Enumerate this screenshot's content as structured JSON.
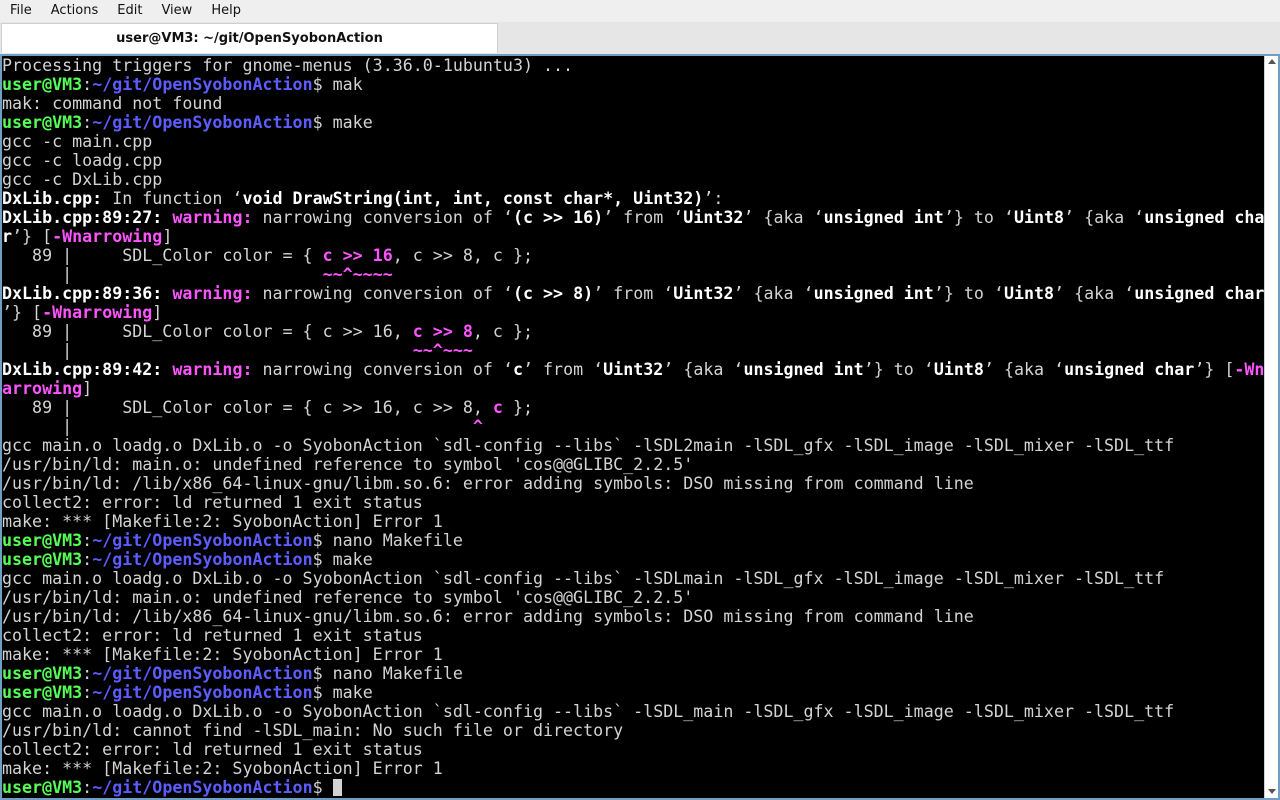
{
  "menubar": {
    "items": [
      "File",
      "Actions",
      "Edit",
      "View",
      "Help"
    ]
  },
  "tab": {
    "title": "user@VM3: ~/git/OpenSyobonAction"
  },
  "prompt": {
    "user": "user@VM3",
    "path": "~/git/OpenSyobonAction"
  },
  "lines": [
    [
      [
        "",
        "Processing triggers for gnome-menus (3.36.0-1ubuntu3) ..."
      ]
    ],
    [
      [
        "pu",
        "user@VM3"
      ],
      [
        "",
        ":"
      ],
      [
        "pp",
        "~/git/OpenSyobonAction"
      ],
      [
        "",
        "$ mak"
      ]
    ],
    [
      [
        "",
        "mak: command not found"
      ]
    ],
    [
      [
        "pu",
        "user@VM3"
      ],
      [
        "",
        ":"
      ],
      [
        "pp",
        "~/git/OpenSyobonAction"
      ],
      [
        "",
        "$ make"
      ]
    ],
    [
      [
        "",
        "gcc -c main.cpp"
      ]
    ],
    [
      [
        "",
        "gcc -c loadg.cpp"
      ]
    ],
    [
      [
        "",
        "gcc -c DxLib.cpp"
      ]
    ],
    [
      [
        "b",
        "DxLib.cpp:"
      ],
      [
        "",
        " In function ‘"
      ],
      [
        "b",
        "void DrawString(int, int, const char*, Uint32)"
      ],
      [
        "",
        "’:"
      ]
    ],
    [
      [
        "b",
        "DxLib.cpp:89:27:"
      ],
      [
        "",
        " "
      ],
      [
        "w",
        "warning:"
      ],
      [
        "",
        " narrowing conversion of ‘"
      ],
      [
        "b",
        "(c >> 16)"
      ],
      [
        "",
        "’ from ‘"
      ],
      [
        "b",
        "Uint32"
      ],
      [
        "",
        "’ {aka ‘"
      ],
      [
        "b",
        "unsigned int"
      ],
      [
        "",
        "’} to ‘"
      ],
      [
        "b",
        "Uint8"
      ],
      [
        "",
        "’ {aka ‘"
      ],
      [
        "b",
        "unsigned cha"
      ]
    ],
    [
      [
        "b",
        "r"
      ],
      [
        "",
        "’} ["
      ],
      [
        "w",
        "-Wnarrowing"
      ],
      [
        "",
        "]"
      ]
    ],
    [
      [
        "",
        "   89 |     SDL_Color color = { "
      ],
      [
        "m",
        "c >> 16"
      ],
      [
        "",
        ", c >> 8, c };"
      ]
    ],
    [
      [
        "",
        "      |                         "
      ],
      [
        "m",
        "~~^~~~~"
      ]
    ],
    [
      [
        "b",
        "DxLib.cpp:89:36:"
      ],
      [
        "",
        " "
      ],
      [
        "w",
        "warning:"
      ],
      [
        "",
        " narrowing conversion of ‘"
      ],
      [
        "b",
        "(c >> 8)"
      ],
      [
        "",
        "’ from ‘"
      ],
      [
        "b",
        "Uint32"
      ],
      [
        "",
        "’ {aka ‘"
      ],
      [
        "b",
        "unsigned int"
      ],
      [
        "",
        "’} to ‘"
      ],
      [
        "b",
        "Uint8"
      ],
      [
        "",
        "’ {aka ‘"
      ],
      [
        "b",
        "unsigned char"
      ]
    ],
    [
      [
        "",
        "’} ["
      ],
      [
        "w",
        "-Wnarrowing"
      ],
      [
        "",
        "]"
      ]
    ],
    [
      [
        "",
        "   89 |     SDL_Color color = { c >> 16, "
      ],
      [
        "m",
        "c >> 8"
      ],
      [
        "",
        ", c };"
      ]
    ],
    [
      [
        "",
        "      |                                  "
      ],
      [
        "m",
        "~~^~~~"
      ]
    ],
    [
      [
        "b",
        "DxLib.cpp:89:42:"
      ],
      [
        "",
        " "
      ],
      [
        "w",
        "warning:"
      ],
      [
        "",
        " narrowing conversion of ‘"
      ],
      [
        "b",
        "c"
      ],
      [
        "",
        "’ from ‘"
      ],
      [
        "b",
        "Uint32"
      ],
      [
        "",
        "’ {aka ‘"
      ],
      [
        "b",
        "unsigned int"
      ],
      [
        "",
        "’} to ‘"
      ],
      [
        "b",
        "Uint8"
      ],
      [
        "",
        "’ {aka ‘"
      ],
      [
        "b",
        "unsigned char"
      ],
      [
        "",
        "’} ["
      ],
      [
        "w",
        "-Wn"
      ]
    ],
    [
      [
        "w",
        "arrowing"
      ],
      [
        "",
        "]"
      ]
    ],
    [
      [
        "",
        "   89 |     SDL_Color color = { c >> 16, c >> 8, "
      ],
      [
        "m",
        "c"
      ],
      [
        "",
        " };"
      ]
    ],
    [
      [
        "",
        "      |                                        "
      ],
      [
        "m",
        "^"
      ]
    ],
    [
      [
        "",
        "gcc main.o loadg.o DxLib.o -o SyobonAction `sdl-config --libs` -lSDL2main -lSDL_gfx -lSDL_image -lSDL_mixer -lSDL_ttf"
      ]
    ],
    [
      [
        "",
        "/usr/bin/ld: main.o: undefined reference to symbol 'cos@@GLIBC_2.2.5'"
      ]
    ],
    [
      [
        "",
        "/usr/bin/ld: /lib/x86_64-linux-gnu/libm.so.6: error adding symbols: DSO missing from command line"
      ]
    ],
    [
      [
        "",
        "collect2: error: ld returned 1 exit status"
      ]
    ],
    [
      [
        "",
        "make: *** [Makefile:2: SyobonAction] Error 1"
      ]
    ],
    [
      [
        "pu",
        "user@VM3"
      ],
      [
        "",
        ":"
      ],
      [
        "pp",
        "~/git/OpenSyobonAction"
      ],
      [
        "",
        "$ nano Makefile"
      ]
    ],
    [
      [
        "pu",
        "user@VM3"
      ],
      [
        "",
        ":"
      ],
      [
        "pp",
        "~/git/OpenSyobonAction"
      ],
      [
        "",
        "$ make"
      ]
    ],
    [
      [
        "",
        "gcc main.o loadg.o DxLib.o -o SyobonAction `sdl-config --libs` -lSDLmain -lSDL_gfx -lSDL_image -lSDL_mixer -lSDL_ttf"
      ]
    ],
    [
      [
        "",
        "/usr/bin/ld: main.o: undefined reference to symbol 'cos@@GLIBC_2.2.5'"
      ]
    ],
    [
      [
        "",
        "/usr/bin/ld: /lib/x86_64-linux-gnu/libm.so.6: error adding symbols: DSO missing from command line"
      ]
    ],
    [
      [
        "",
        "collect2: error: ld returned 1 exit status"
      ]
    ],
    [
      [
        "",
        "make: *** [Makefile:2: SyobonAction] Error 1"
      ]
    ],
    [
      [
        "pu",
        "user@VM3"
      ],
      [
        "",
        ":"
      ],
      [
        "pp",
        "~/git/OpenSyobonAction"
      ],
      [
        "",
        "$ nano Makefile"
      ]
    ],
    [
      [
        "pu",
        "user@VM3"
      ],
      [
        "",
        ":"
      ],
      [
        "pp",
        "~/git/OpenSyobonAction"
      ],
      [
        "",
        "$ make"
      ]
    ],
    [
      [
        "",
        "gcc main.o loadg.o DxLib.o -o SyobonAction `sdl-config --libs` -lSDL_main -lSDL_gfx -lSDL_image -lSDL_mixer -lSDL_ttf"
      ]
    ],
    [
      [
        "",
        "/usr/bin/ld: cannot find -lSDL_main: No such file or directory"
      ]
    ],
    [
      [
        "",
        "collect2: error: ld returned 1 exit status"
      ]
    ],
    [
      [
        "",
        "make: *** [Makefile:2: SyobonAction] Error 1"
      ]
    ],
    [
      [
        "pu",
        "user@VM3"
      ],
      [
        "",
        ":"
      ],
      [
        "pp",
        "~/git/OpenSyobonAction"
      ],
      [
        "",
        "$ "
      ]
    ]
  ]
}
